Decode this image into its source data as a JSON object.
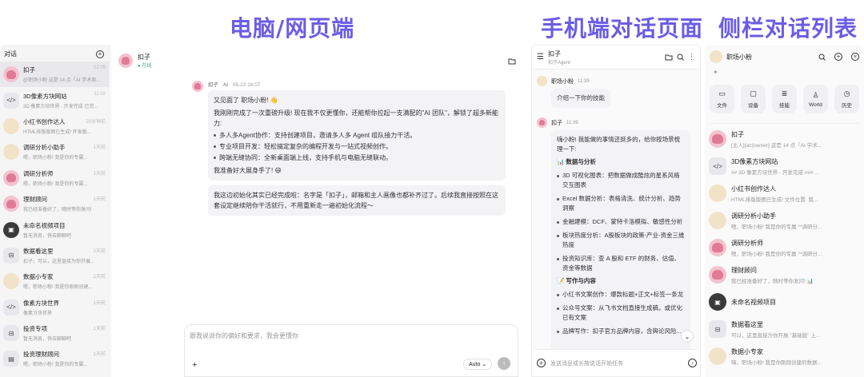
{
  "headings": {
    "desktop": "电脑/网页端",
    "mobile": "手机端对话页面",
    "sidebar": "侧栏对话列表"
  },
  "desktop": {
    "sidebar_title": "对话",
    "items": [
      {
        "name": "扣子",
        "preview": "@职场小粉 这是 14 点「AI 学术周...",
        "time": "12:05",
        "avatar": "ghost",
        "selected": true
      },
      {
        "name": "3D像素方块网站",
        "preview": "3D 像素方块世界 - 开发完成 已完...",
        "time": "11:02",
        "avatar": "</>"
      },
      {
        "name": "小红书创作达人",
        "preview": "HTML排版版图已生成! 开发版...",
        "time": "20分钟前",
        "avatar": "chip"
      },
      {
        "name": "调研分析小助手",
        "preview": "嗯，职场小粉! 我是你的专属...",
        "time": "1天前",
        "avatar": "chip"
      },
      {
        "name": "调研分析师",
        "preview": "嗯，职场小粉! 我是你的专属...",
        "time": "1天前",
        "avatar": "ghost"
      },
      {
        "name": "理财顾问",
        "preview": "我已经准备好了，随时等你发问!",
        "time": "1天前",
        "avatar": "ghost"
      },
      {
        "name": "未命名视频项目",
        "preview": "暂无消息，快去聊聊吧",
        "time": "",
        "avatar": "▣"
      },
      {
        "name": "数据看这里",
        "preview": "扣子，可以，这里直接为你开展...",
        "time": "2天前",
        "avatar": "⊟"
      },
      {
        "name": "数据小专家",
        "preview": "嗯，职场小粉! 我是你刚刚创建...",
        "time": "2天前",
        "avatar": "chip"
      },
      {
        "name": "像素方块世界",
        "preview": "像素方块世界",
        "time": "1天前",
        "avatar": "</>"
      },
      {
        "name": "投资专项",
        "preview": "暂无消息，快去聊聊吧",
        "time": "1天前",
        "avatar": "⊟"
      },
      {
        "name": "投资理财顾问",
        "preview": "嗯，职场小粉! 我是你的专属...",
        "time": "1天前",
        "avatar": "▤"
      }
    ],
    "chat_title": "扣子",
    "chat_status": "● 在线",
    "msg_meta": {
      "name": "扣子",
      "tag": "AI",
      "time": "05-22 16:07"
    },
    "bubble1": {
      "greeting": "又见面了 职场小粉! 👋",
      "intro": "我刚刚完成了一次重磅升级! 现在我不仅更懂你，还能帮你拉起一支满配的\"AI 团队\"，解锁了超多新能力:",
      "bullets": [
        "多人多Agent协作：支持创建项目，邀请多人多 Agent 组队接力干活。",
        "专业项目开发：轻松搞定复杂的编程开发与一站式视频创作。",
        "跨端无缝协同：全新桌面端上线，支持手机与电脑无缝联动。"
      ],
      "outro": "我准备好大展身手了! 😄"
    },
    "bubble2": "我这边初始化其实已经完成啦：名字是「扣子」，邮箱和主人画像也都补齐过了。后续我直接按照在这套设定继续陪你干活就行，不用重新走一遍初始化流程～",
    "input_placeholder": "跟我说说你的偏好和要求，我会更懂你",
    "model": "Auto"
  },
  "mobile": {
    "title": "扣子",
    "subtitle": "扣子Agent",
    "user_name": "职场小粉",
    "user_time": "11:39",
    "user_msg": "介绍一下你的技能",
    "bot_name": "扣子",
    "bot_time": "11:39",
    "bot_intro": "嗨小粉! 我能做的事情还挺多的，给你按场景梳理一下:",
    "sections": [
      {
        "title": "📊 数据与分析",
        "bullets": [
          "3D 可视化图表：把数据做成酷炫的星系风格交互图表",
          "Excel 数据分析：表格清洗、统计分析、趋势洞察",
          "金融建模：DCF、蒙特卡洛模拟、敏感性分析",
          "板块热度分析：A股板块的政策-产业-资金三维热度",
          "投资知识库：查 A 股和 ETF 的财务、估值、资金等数据"
        ]
      },
      {
        "title": "📝 写作与内容",
        "bullets": [
          "小红书文案创作：爆款标题+正文+标签一条龙",
          "公众号文案：从飞书文档直接生成稿，或优化已有文案",
          "品牌写作：扣子官方品牌内容，含舆论风险..."
        ]
      }
    ],
    "input_placeholder": "发送消息或长按说话开始任务"
  },
  "sidebar": {
    "user_name": "职场小粉",
    "tools": [
      {
        "label": "文件",
        "icon": "folder-icon"
      },
      {
        "label": "设备",
        "icon": "device-icon"
      },
      {
        "label": "技能",
        "icon": "skill-icon"
      },
      {
        "label": "World",
        "icon": "world-icon"
      },
      {
        "label": "历史",
        "icon": "history-icon"
      }
    ],
    "items": [
      {
        "name": "扣子",
        "preview": "[主人]{at:{owner} 这是 14 点「AI 学术...",
        "avatar": "ghost"
      },
      {
        "name": "3D像素方块网站",
        "preview": "## 3D 像素方块世界 - 开发完成 ### ...",
        "avatar": "</>"
      },
      {
        "name": "小红书创作达人",
        "preview": "HTML排版版图已生成! 文件位置: 我...",
        "avatar": "chip"
      },
      {
        "name": "调研分析小助手",
        "preview": "嗯，职场小粉! 我是你的专属 **调研分...",
        "avatar": "chip"
      },
      {
        "name": "调研分析师",
        "preview": "嗯，职场小粉! 我是你的专属 **调研分...",
        "avatar": "ghost"
      },
      {
        "name": "理财顾问",
        "preview": "我已经准备好了，随时等你发问! 📊",
        "avatar": "ghost"
      },
      {
        "name": "未命名视频项目",
        "preview": "",
        "avatar": "▣"
      },
      {
        "name": "数据看这里",
        "preview": "可以，这里直接为你开展 \"基础版\" 上...",
        "avatar": "⊟"
      },
      {
        "name": "数据小专家",
        "preview": "嗨，职场小粉! 我是你刚刚创建的数据...",
        "avatar": "chip"
      }
    ]
  }
}
